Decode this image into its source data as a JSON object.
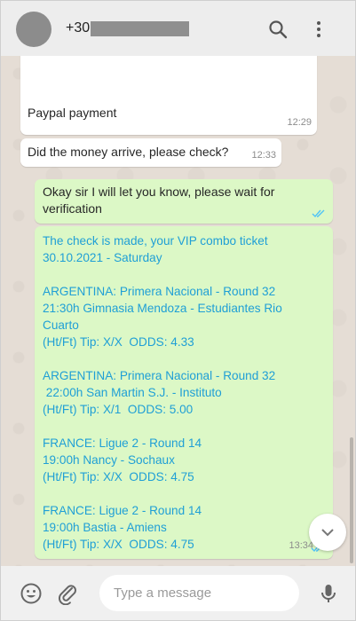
{
  "header": {
    "contact_number": "+30",
    "icons": [
      "search-icon",
      "menu-icon"
    ]
  },
  "messages": [
    {
      "text": "Paypal payment",
      "time": "12:29"
    },
    {
      "text": "Did the money arrive, please check?",
      "time": "12:33"
    },
    {
      "text": "Okay sir I will let you know, please wait for verification",
      "status": "read"
    },
    {
      "lines": [
        "The check is made, your VIP combo ticket",
        "30.10.2021 - Saturday",
        "",
        "ARGENTINA: Primera Nacional - Round 32",
        "21:30h Gimnasia Mendoza - Estudiantes Rio",
        "Cuarto",
        "(Ht/Ft) Tip: X/X  ODDS: 4.33",
        "",
        "ARGENTINA: Primera Nacional - Round 32",
        " 22:00h San Martin S.J. - Instituto",
        "(Ht/Ft) Tip: X/1  ODDS: 5.00",
        "",
        "FRANCE: Ligue 2 - Round 14",
        "19:00h Nancy - Sochaux",
        "(Ht/Ft) Tip: X/X  ODDS: 4.75",
        "",
        "FRANCE: Ligue 2 - Round 14",
        "19:00h Bastia - Amiens",
        "(Ht/Ft) Tip: X/X  ODDS: 4.75"
      ],
      "time": "13:34",
      "status": "read"
    }
  ],
  "composer": {
    "placeholder": "Type a message"
  },
  "colors": {
    "outgoing_bubble": "#dcf8c6",
    "incoming_bubble": "#ffffff",
    "chat_background": "#e5ddd5",
    "ticket_text": "#1f9fd6",
    "read_ticks": "#4fc3f7"
  }
}
